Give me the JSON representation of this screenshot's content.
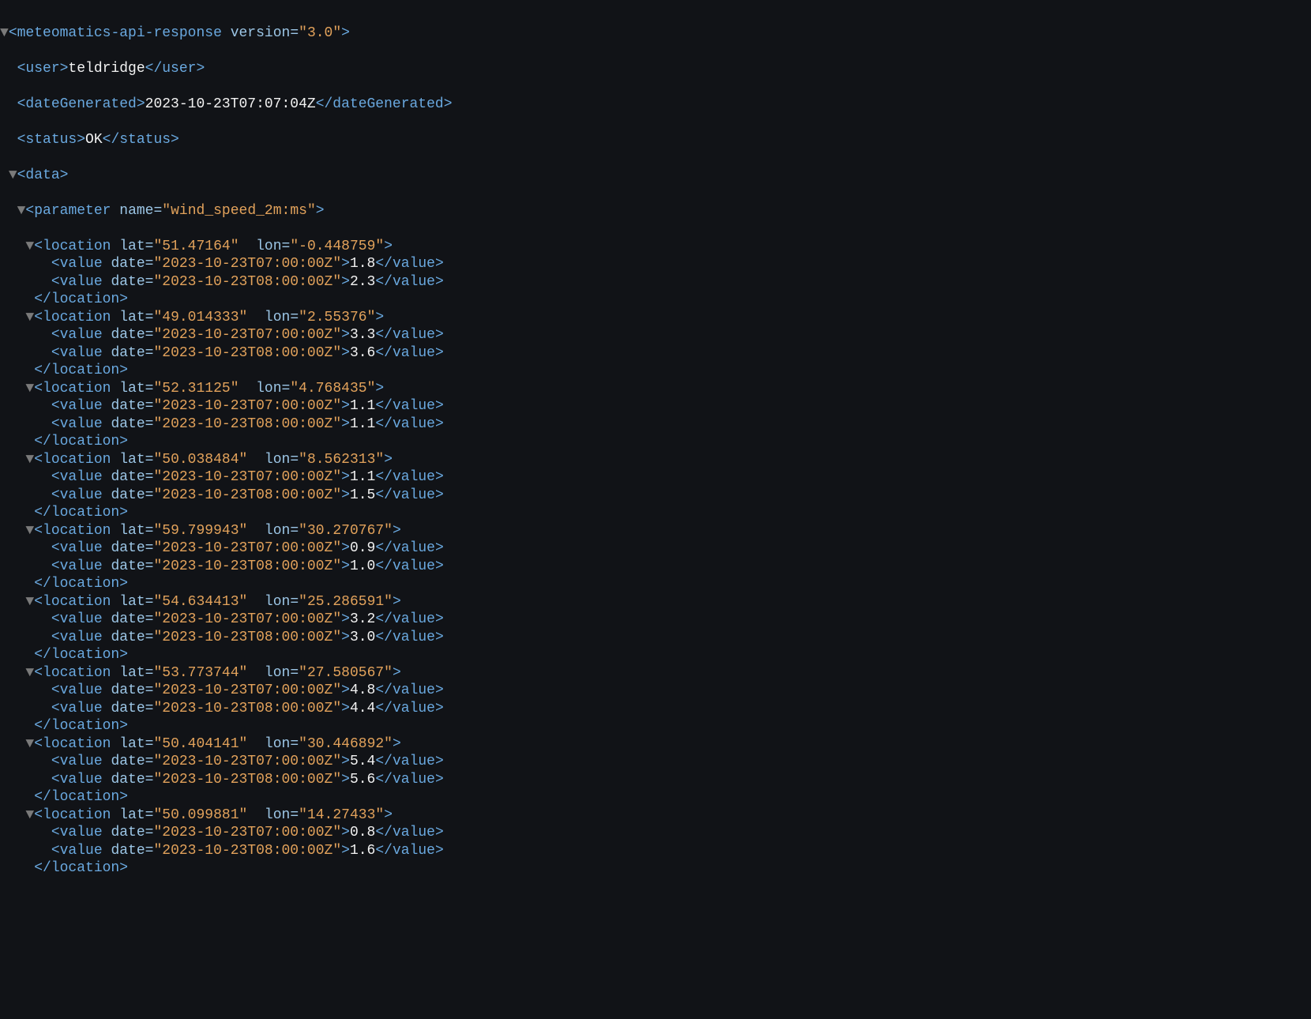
{
  "root": {
    "tag": "meteomatics-api-response",
    "attrs": {
      "version": "3.0"
    }
  },
  "user": "teldridge",
  "dateGenerated": "2023-10-23T07:07:04Z",
  "status": "OK",
  "parameter": {
    "tag": "parameter",
    "attrs": {
      "name": "wind_speed_2m:ms"
    }
  },
  "locations": [
    {
      "lat": "51.47164",
      "lon": "-0.448759",
      "values": [
        {
          "date": "2023-10-23T07:00:00Z",
          "v": "1.8"
        },
        {
          "date": "2023-10-23T08:00:00Z",
          "v": "2.3"
        }
      ]
    },
    {
      "lat": "49.014333",
      "lon": "2.55376",
      "values": [
        {
          "date": "2023-10-23T07:00:00Z",
          "v": "3.3"
        },
        {
          "date": "2023-10-23T08:00:00Z",
          "v": "3.6"
        }
      ]
    },
    {
      "lat": "52.31125",
      "lon": "4.768435",
      "values": [
        {
          "date": "2023-10-23T07:00:00Z",
          "v": "1.1"
        },
        {
          "date": "2023-10-23T08:00:00Z",
          "v": "1.1"
        }
      ]
    },
    {
      "lat": "50.038484",
      "lon": "8.562313",
      "values": [
        {
          "date": "2023-10-23T07:00:00Z",
          "v": "1.1"
        },
        {
          "date": "2023-10-23T08:00:00Z",
          "v": "1.5"
        }
      ]
    },
    {
      "lat": "59.799943",
      "lon": "30.270767",
      "values": [
        {
          "date": "2023-10-23T07:00:00Z",
          "v": "0.9"
        },
        {
          "date": "2023-10-23T08:00:00Z",
          "v": "1.0"
        }
      ]
    },
    {
      "lat": "54.634413",
      "lon": "25.286591",
      "values": [
        {
          "date": "2023-10-23T07:00:00Z",
          "v": "3.2"
        },
        {
          "date": "2023-10-23T08:00:00Z",
          "v": "3.0"
        }
      ]
    },
    {
      "lat": "53.773744",
      "lon": "27.580567",
      "values": [
        {
          "date": "2023-10-23T07:00:00Z",
          "v": "4.8"
        },
        {
          "date": "2023-10-23T08:00:00Z",
          "v": "4.4"
        }
      ]
    },
    {
      "lat": "50.404141",
      "lon": "30.446892",
      "values": [
        {
          "date": "2023-10-23T07:00:00Z",
          "v": "5.4"
        },
        {
          "date": "2023-10-23T08:00:00Z",
          "v": "5.6"
        }
      ]
    },
    {
      "lat": "50.099881",
      "lon": "14.27433",
      "values": [
        {
          "date": "2023-10-23T07:00:00Z",
          "v": "0.8"
        },
        {
          "date": "2023-10-23T08:00:00Z",
          "v": "1.6"
        }
      ]
    }
  ]
}
